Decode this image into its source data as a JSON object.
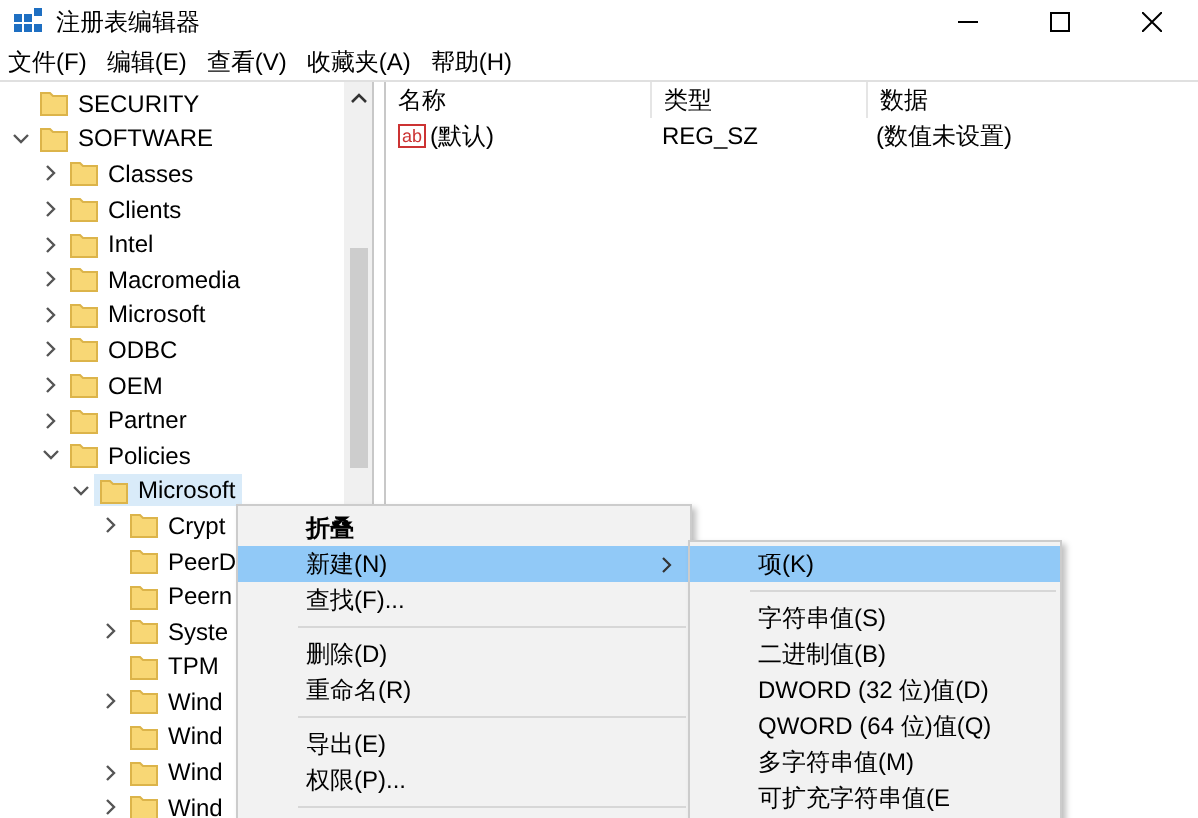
{
  "window": {
    "title": "注册表编辑器"
  },
  "menu_bar": [
    "文件(F)",
    "编辑(E)",
    "查看(V)",
    "收藏夹(A)",
    "帮助(H)"
  ],
  "tree": [
    {
      "label": "SECURITY",
      "kind": "leaf",
      "selected": false
    },
    {
      "label": "SOFTWARE",
      "kind": "branch",
      "expanded": true,
      "selected": false,
      "children": [
        {
          "label": "Classes",
          "kind": "branch",
          "expanded": false,
          "selected": false
        },
        {
          "label": "Clients",
          "kind": "branch",
          "expanded": false,
          "selected": false
        },
        {
          "label": "Intel",
          "kind": "branch",
          "expanded": false,
          "selected": false
        },
        {
          "label": "Macromedia",
          "kind": "branch",
          "expanded": false,
          "selected": false
        },
        {
          "label": "Microsoft",
          "kind": "branch",
          "expanded": false,
          "selected": false
        },
        {
          "label": "ODBC",
          "kind": "branch",
          "expanded": false,
          "selected": false
        },
        {
          "label": "OEM",
          "kind": "branch",
          "expanded": false,
          "selected": false
        },
        {
          "label": "Partner",
          "kind": "branch",
          "expanded": false,
          "selected": false
        },
        {
          "label": "Policies",
          "kind": "branch",
          "expanded": true,
          "selected": false,
          "children": [
            {
              "label": "Microsoft",
              "kind": "branch",
              "expanded": true,
              "selected": true,
              "children": [
                {
                  "label": "Crypt",
                  "kind": "branch",
                  "expanded": false,
                  "selected": false
                },
                {
                  "label": "PeerD",
                  "kind": "leaf",
                  "selected": false
                },
                {
                  "label": "Peern",
                  "kind": "leaf",
                  "selected": false
                },
                {
                  "label": "Syste",
                  "kind": "branch",
                  "expanded": false,
                  "selected": false
                },
                {
                  "label": "TPM",
                  "kind": "leaf",
                  "selected": false
                },
                {
                  "label": "Wind",
                  "kind": "branch",
                  "expanded": false,
                  "selected": false
                },
                {
                  "label": "Wind",
                  "kind": "leaf",
                  "selected": false
                },
                {
                  "label": "Wind",
                  "kind": "branch",
                  "expanded": false,
                  "selected": false
                },
                {
                  "label": "Wind",
                  "kind": "branch",
                  "expanded": false,
                  "selected": false
                }
              ]
            }
          ]
        }
      ]
    }
  ],
  "table": {
    "columns": [
      "名称",
      "类型",
      "数据"
    ],
    "rows": [
      {
        "icon_label": "ab",
        "name": "(默认)",
        "type": "REG_SZ",
        "data": "(数值未设置)"
      }
    ]
  },
  "context_menu": [
    {
      "kind": "item",
      "label": "折叠",
      "bold": true,
      "submenu": false,
      "selected": false
    },
    {
      "kind": "item",
      "label": "新建(N)",
      "bold": false,
      "submenu": true,
      "selected": true
    },
    {
      "kind": "item",
      "label": "查找(F)...",
      "bold": false,
      "submenu": false,
      "selected": false
    },
    {
      "kind": "separator"
    },
    {
      "kind": "item",
      "label": "删除(D)",
      "bold": false,
      "submenu": false,
      "selected": false
    },
    {
      "kind": "item",
      "label": "重命名(R)",
      "bold": false,
      "submenu": false,
      "selected": false
    },
    {
      "kind": "separator"
    },
    {
      "kind": "item",
      "label": "导出(E)",
      "bold": false,
      "submenu": false,
      "selected": false
    },
    {
      "kind": "item",
      "label": "权限(P)...",
      "bold": false,
      "submenu": false,
      "selected": false
    },
    {
      "kind": "separator"
    }
  ],
  "submenu": [
    {
      "kind": "item",
      "label": "项(K)",
      "selected": true
    },
    {
      "kind": "separator"
    },
    {
      "kind": "item",
      "label": "字符串值(S)",
      "selected": false
    },
    {
      "kind": "item",
      "label": "二进制值(B)",
      "selected": false
    },
    {
      "kind": "item",
      "label": "DWORD (32 位)值(D)",
      "selected": false
    },
    {
      "kind": "item",
      "label": "QWORD (64 位)值(Q)",
      "selected": false
    },
    {
      "kind": "item",
      "label": "多字符串值(M)",
      "selected": false
    },
    {
      "kind": "item",
      "label": "可扩充字符串值(E",
      "selected": false
    }
  ]
}
